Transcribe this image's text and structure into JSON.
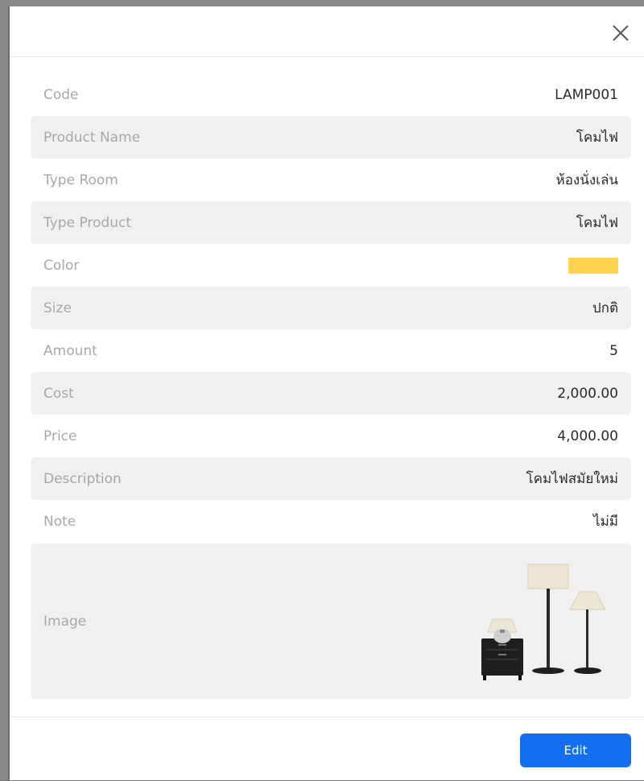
{
  "modal": {
    "close_icon": "close-icon"
  },
  "details": [
    {
      "key": "code",
      "label": "Code",
      "value": "LAMP001"
    },
    {
      "key": "product_name",
      "label": "Product Name",
      "value": "โคมไฟ"
    },
    {
      "key": "type_room",
      "label": "Type Room",
      "value": "ห้องนั่งเล่น"
    },
    {
      "key": "type_product",
      "label": "Type Product",
      "value": "โคมไฟ"
    },
    {
      "key": "color",
      "label": "Color",
      "value": "",
      "swatch_color": "#ffd34f"
    },
    {
      "key": "size",
      "label": "Size",
      "value": "ปกติ"
    },
    {
      "key": "amount",
      "label": "Amount",
      "value": "5"
    },
    {
      "key": "cost",
      "label": "Cost",
      "value": "2,000.00"
    },
    {
      "key": "price",
      "label": "Price",
      "value": "4,000.00"
    },
    {
      "key": "description",
      "label": "Description",
      "value": "โคมไฟสมัยใหม่"
    },
    {
      "key": "note",
      "label": "Note",
      "value": "ไม่มี"
    },
    {
      "key": "image",
      "label": "Image",
      "image_icon": "lamp-set-image"
    }
  ],
  "footer": {
    "edit_label": "Edit"
  },
  "colors": {
    "accent": "#1270f0",
    "row_shade": "#f0f0f0",
    "label_text": "#a8a8a8",
    "value_text": "#2b2b2b"
  }
}
